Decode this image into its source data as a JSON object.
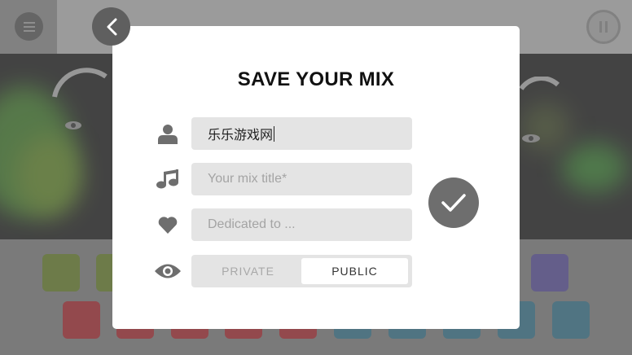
{
  "modal": {
    "title": "SAVE YOUR MIX",
    "author_field": {
      "value": "乐乐游戏网",
      "placeholder": ""
    },
    "title_field": {
      "value": "",
      "placeholder": "Your mix title*"
    },
    "dedicated_field": {
      "value": "",
      "placeholder": "Dedicated to ..."
    },
    "visibility": {
      "options": [
        "PRIVATE",
        "PUBLIC"
      ],
      "selected": "PUBLIC"
    }
  },
  "icons": {
    "menu": "menu-icon",
    "pause": "pause-icon",
    "back": "chevron-left-icon",
    "user": "user-icon",
    "music": "music-note-icon",
    "heart": "heart-icon",
    "eye": "eye-icon",
    "confirm": "checkmark-icon"
  },
  "colors": {
    "overlay": "#7b7b7b",
    "modal_bg": "#ffffff",
    "field_bg": "#e4e4e4",
    "button_gray": "#6e6e6e",
    "pad_green": "#5f7f10",
    "pad_red": "#b3111a",
    "pad_teal": "#1f6f8f",
    "pad_purple": "#4d3fa0"
  }
}
